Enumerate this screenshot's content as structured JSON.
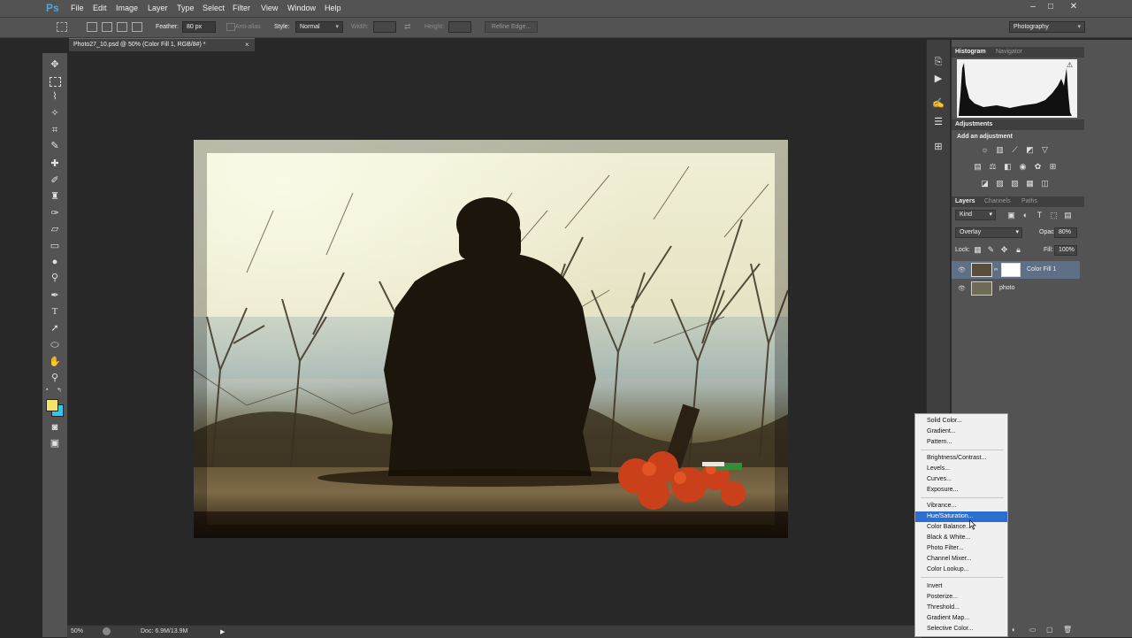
{
  "menubar": {
    "logo": "Ps",
    "items": [
      "File",
      "Edit",
      "Image",
      "Layer",
      "Type",
      "Select",
      "Filter",
      "View",
      "Window",
      "Help"
    ],
    "window_controls": [
      "–",
      "□",
      "✕"
    ]
  },
  "options": {
    "feather_label": "Feather:",
    "feather_value": "80 px",
    "antialias_label": "Anti-alias",
    "style_label": "Style:",
    "style_value": "Normal",
    "width_label": "Width:",
    "height_label": "Height:",
    "refine_edge": "Refine Edge...",
    "workspace": "Photography"
  },
  "document": {
    "tab_title": "Photo27_10.psd @ 50% (Color Fill 1, RGB/8#) *",
    "close": "×",
    "zoom": "50%",
    "doc_info": "Doc: 6.9M/13.9M"
  },
  "panels": {
    "histogram_tab": "Histogram",
    "navigator_tab": "Navigator",
    "adjustments_tab": "Adjustments",
    "add_adjustment": "Add an adjustment",
    "layers_tab": "Layers",
    "channels_tab": "Channels",
    "paths_tab": "Paths",
    "kind": "Kind",
    "blend_mode": "Overlay",
    "opacity_label": "Opacity:",
    "opacity_value": "80%",
    "lock_label": "Lock:",
    "fill_label": "Fill:",
    "fill_value": "100%",
    "layers": [
      {
        "name": "Color Fill 1",
        "selected": true
      },
      {
        "name": "photo",
        "selected": false
      }
    ]
  },
  "adjustment_menu": {
    "groups": [
      [
        "Solid Color...",
        "Gradient...",
        "Pattern..."
      ],
      [
        "Brightness/Contrast...",
        "Levels...",
        "Curves...",
        "Exposure..."
      ],
      [
        "Vibrance...",
        "Hue/Saturation...",
        "Color Balance...",
        "Black & White...",
        "Photo Filter...",
        "Channel Mixer...",
        "Color Lookup..."
      ],
      [
        "Invert",
        "Posterize...",
        "Threshold...",
        "Gradient Map...",
        "Selective Color..."
      ]
    ],
    "highlighted": "Hue/Saturation..."
  },
  "colors": {
    "ui_dark": "#282828",
    "ui_mid": "#535353",
    "highlight": "#2d6fd1",
    "foreground_swatch": "#f4e46a",
    "background_swatch": "#36c7e8",
    "ps_blue": "#46a8e8"
  }
}
